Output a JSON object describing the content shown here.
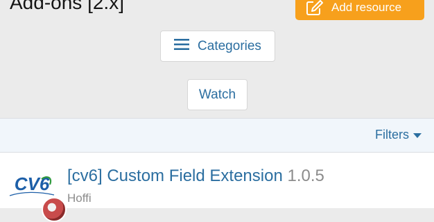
{
  "header": {
    "title": "Add-ons [2.x]",
    "add_resource_label": "Add resource",
    "add_resource_color": "#f7a01c"
  },
  "actions": {
    "categories_label": "Categories",
    "watch_label": "Watch"
  },
  "filter_bar": {
    "filters_label": "Filters"
  },
  "resources": [
    {
      "title": "[cv6] Custom Field Extension",
      "version": "1.0.5",
      "author": "Hoffi",
      "logo_text": "CV6"
    }
  ],
  "colors": {
    "link": "#2b6ea0",
    "muted": "#8c8c8c",
    "background": "#ebebeb"
  }
}
